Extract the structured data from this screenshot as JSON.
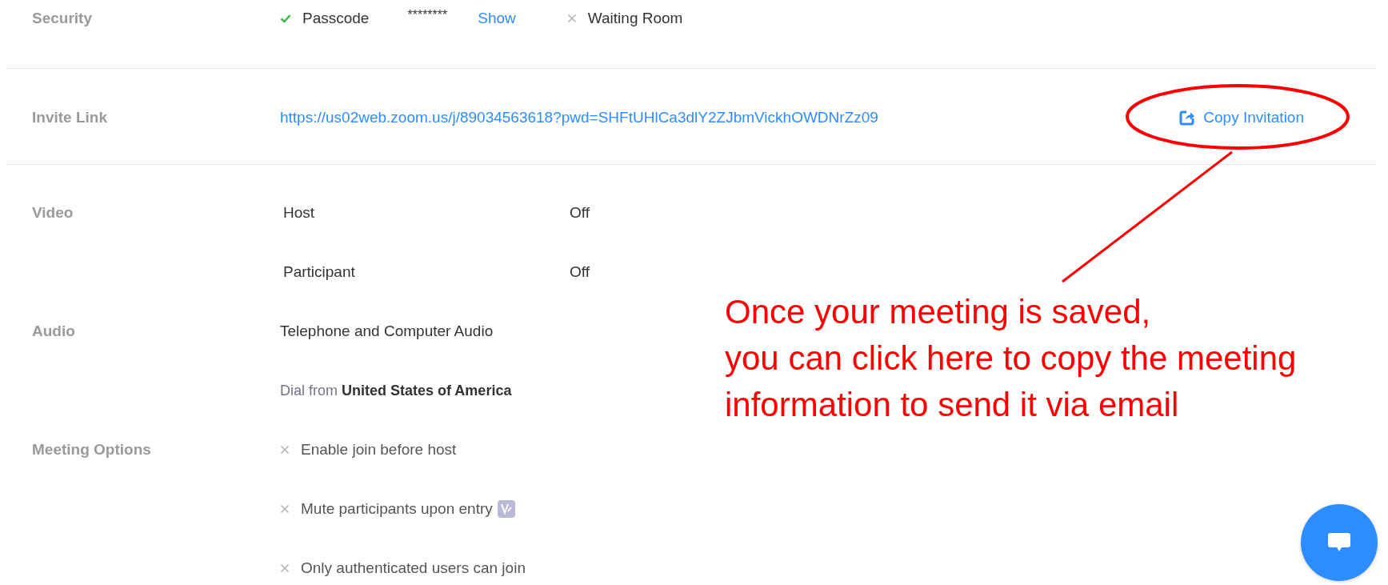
{
  "security": {
    "label": "Security",
    "passcode": {
      "checked": true,
      "label": "Passcode",
      "value": "********",
      "show_link": "Show"
    },
    "waiting_room": {
      "checked": false,
      "label": "Waiting Room"
    }
  },
  "invite": {
    "label": "Invite Link",
    "url": "https://us02web.zoom.us/j/89034563618?pwd=SHFtUHlCa3dlY2ZJbmVickhOWDNrZz09",
    "copy_button": "Copy Invitation"
  },
  "video": {
    "label": "Video",
    "items": [
      {
        "name": "Host",
        "value": "Off"
      },
      {
        "name": "Participant",
        "value": "Off"
      }
    ]
  },
  "audio": {
    "label": "Audio",
    "type": "Telephone and Computer Audio",
    "dial_from": "Dial from **United States of America**"
  },
  "meeting_options": {
    "label": "Meeting Options",
    "options": [
      {
        "text": "Enable join before host",
        "checked": false,
        "badge": false
      },
      {
        "text": "Mute participants upon entry",
        "checked": false,
        "badge": true
      },
      {
        "text": "Only authenticated users can join",
        "checked": false,
        "badge": false
      }
    ]
  },
  "annotation": {
    "text": "Once your meeting is saved,\nyou can click here to copy the meeting\ninformation to send it via email"
  }
}
